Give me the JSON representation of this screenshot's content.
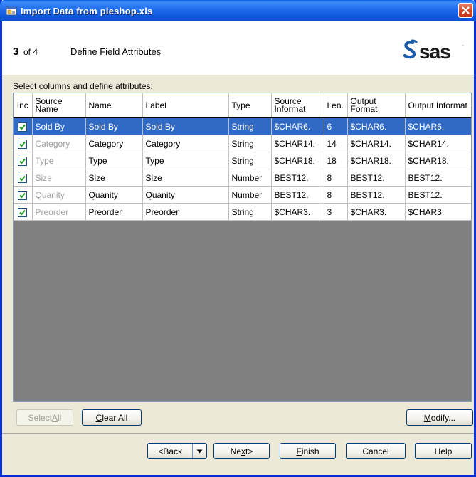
{
  "window": {
    "title": "Import Data from pieshop.xls"
  },
  "header": {
    "step_number": "3",
    "step_of": "of 4",
    "step_title": "Define Field Attributes",
    "logo": "sas-logo"
  },
  "grid": {
    "label_prefix": "S",
    "label_rest": "elect columns and define attributes:",
    "columns": [
      "Inc",
      "Source Name",
      "Name",
      "Label",
      "Type",
      "Source Informat",
      "Len.",
      "Output Format",
      "Output Informat"
    ],
    "rows": [
      {
        "included": true,
        "source_name": "Sold By",
        "name": "Sold By",
        "label": "Sold By",
        "type": "String",
        "source_informat": "$CHAR6.",
        "len": "6",
        "output_format": "$CHAR6.",
        "output_informat": "$CHAR6.",
        "selected": true
      },
      {
        "included": true,
        "source_name": "Category",
        "name": "Category",
        "label": "Category",
        "type": "String",
        "source_informat": "$CHAR14.",
        "len": "14",
        "output_format": "$CHAR14.",
        "output_informat": "$CHAR14."
      },
      {
        "included": true,
        "source_name": "Type",
        "name": "Type",
        "label": "Type",
        "type": "String",
        "source_informat": "$CHAR18.",
        "len": "18",
        "output_format": "$CHAR18.",
        "output_informat": "$CHAR18."
      },
      {
        "included": true,
        "source_name": "Size",
        "name": "Size",
        "label": "Size",
        "type": "Number",
        "source_informat": "BEST12.",
        "len": "8",
        "output_format": "BEST12.",
        "output_informat": "BEST12."
      },
      {
        "included": true,
        "source_name": "Quanity",
        "name": "Quanity",
        "label": "Quanity",
        "type": "Number",
        "source_informat": "BEST12.",
        "len": "8",
        "output_format": "BEST12.",
        "output_informat": "BEST12."
      },
      {
        "included": true,
        "source_name": "Preorder",
        "name": "Preorder",
        "label": "Preorder",
        "type": "String",
        "source_informat": "$CHAR3.",
        "len": "3",
        "output_format": "$CHAR3.",
        "output_informat": "$CHAR3."
      }
    ]
  },
  "buttons": {
    "select_all_a": "Select ",
    "select_all_b": "A",
    "select_all_c": "ll",
    "clear_all_a": "C",
    "clear_all_b": "lear All",
    "modify_a": "M",
    "modify_b": "odify...",
    "back_a": "<",
    "back_b": "B",
    "back_c": "ack",
    "next_a": "Ne",
    "next_b": "x",
    "next_c": "t>",
    "finish_a": "F",
    "finish_b": "inish",
    "cancel": "Cancel",
    "help": "Help"
  },
  "colors": {
    "title_bar": "#0a5fe6",
    "selection": "#316ac5",
    "close_button": "#d04b2b",
    "grid_empty": "#808080"
  }
}
